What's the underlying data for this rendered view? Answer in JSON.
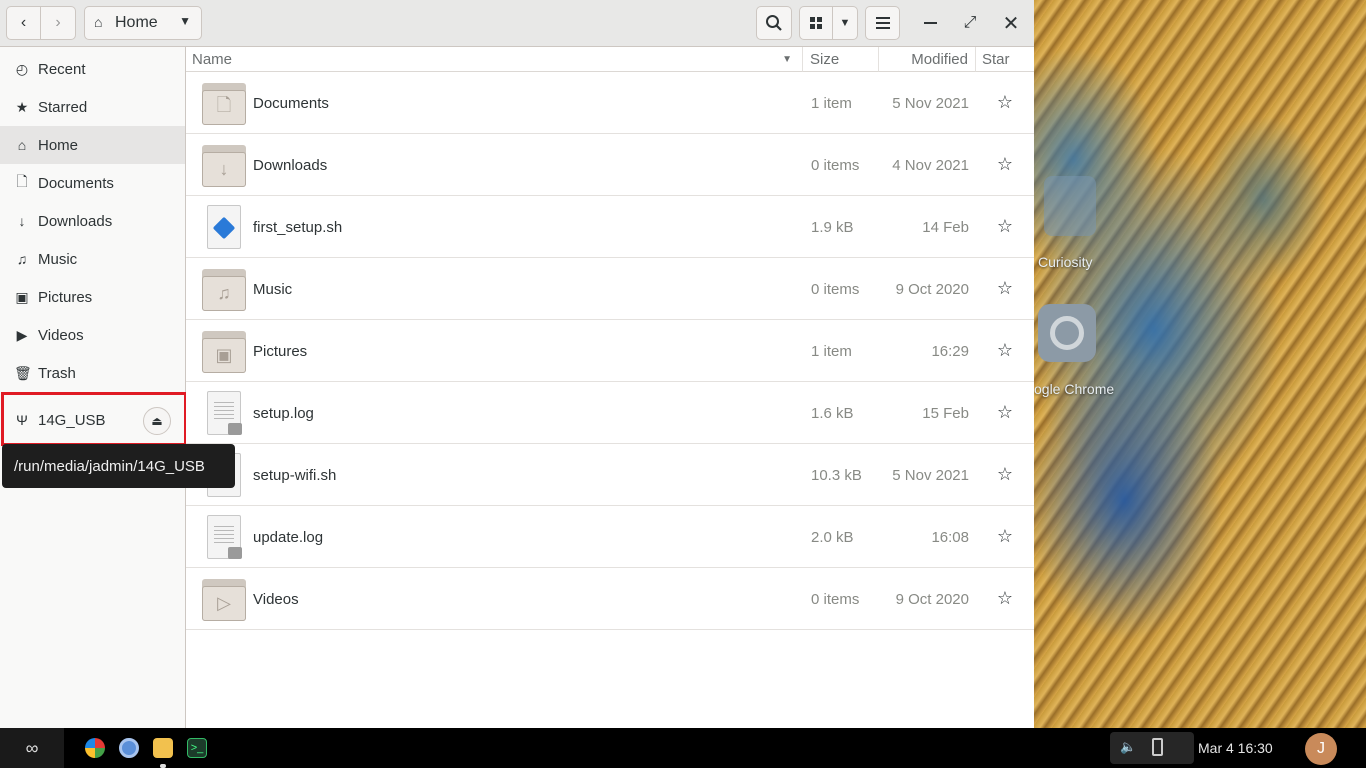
{
  "window": {
    "location_label": "Home"
  },
  "sidebar": {
    "items": [
      {
        "label": "Recent",
        "icon": "clock-icon"
      },
      {
        "label": "Starred",
        "icon": "star-icon"
      },
      {
        "label": "Home",
        "icon": "home-icon"
      },
      {
        "label": "Documents",
        "icon": "document-icon"
      },
      {
        "label": "Downloads",
        "icon": "download-icon"
      },
      {
        "label": "Music",
        "icon": "music-icon"
      },
      {
        "label": "Pictures",
        "icon": "camera-icon"
      },
      {
        "label": "Videos",
        "icon": "video-icon"
      },
      {
        "label": "Trash",
        "icon": "trash-icon"
      }
    ],
    "device": {
      "label": "14G_USB",
      "icon": "usb-icon"
    },
    "tooltip": "/run/media/jadmin/14G_USB"
  },
  "columns": {
    "name": "Name",
    "size": "Size",
    "modified": "Modified",
    "star": "Star"
  },
  "files": [
    {
      "name": "Documents",
      "size": "1 item",
      "modified": "5 Nov 2021",
      "type": "folder",
      "glyph": "document-icon"
    },
    {
      "name": "Downloads",
      "size": "0 items",
      "modified": "4 Nov 2021",
      "type": "folder",
      "glyph": "download-icon"
    },
    {
      "name": "first_setup.sh",
      "size": "1.9 kB",
      "modified": "14 Feb",
      "type": "script"
    },
    {
      "name": "Music",
      "size": "0 items",
      "modified": "9 Oct 2020",
      "type": "folder",
      "glyph": "music-icon"
    },
    {
      "name": "Pictures",
      "size": "1 item",
      "modified": "16:29",
      "type": "folder",
      "glyph": "camera-icon"
    },
    {
      "name": "setup.log",
      "size": "1.6 kB",
      "modified": "15 Feb",
      "type": "text"
    },
    {
      "name": "setup-wifi.sh",
      "size": "10.3 kB",
      "modified": "5 Nov 2021",
      "type": "script"
    },
    {
      "name": "update.log",
      "size": "2.0 kB",
      "modified": "16:08",
      "type": "text"
    },
    {
      "name": "Videos",
      "size": "0 items",
      "modified": "9 Oct 2020",
      "type": "folder",
      "glyph": "video-icon"
    }
  ],
  "desktop": {
    "icons": [
      {
        "label": "Curiosity"
      },
      {
        "label": "ogle Chrome"
      }
    ]
  },
  "taskbar": {
    "clock": "Mar 4  16:30",
    "avatar_initial": "J"
  }
}
